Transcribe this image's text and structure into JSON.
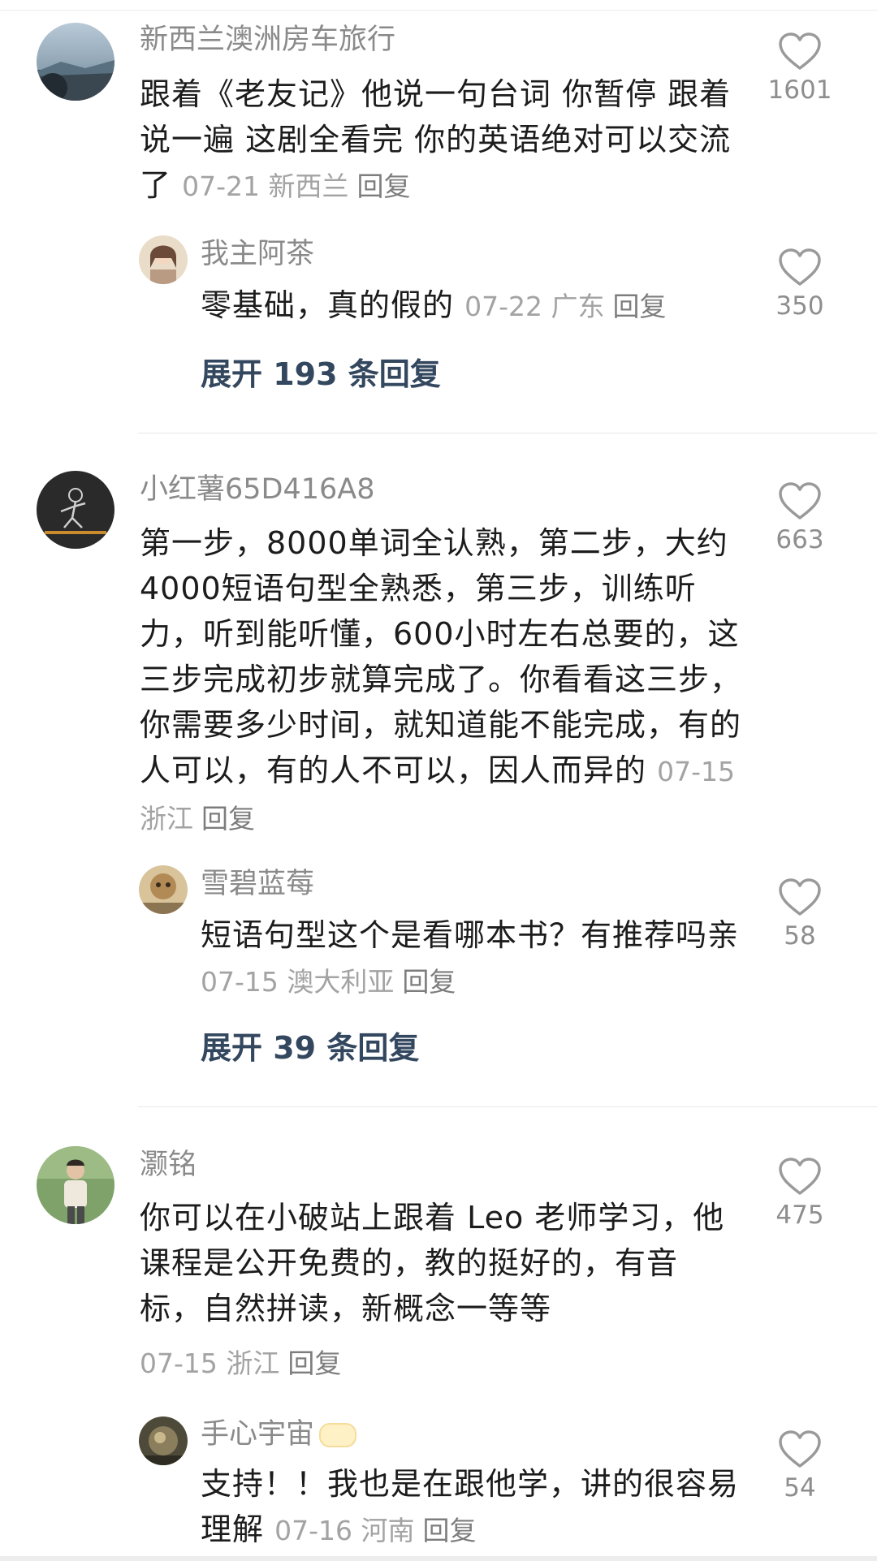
{
  "threads": [
    {
      "user": "新西兰澳洲房车旅行",
      "text": "跟着《老友记》他说一句台词 你暂停 跟着说一遍 这剧全看完 你的英语绝对可以交流了",
      "date": "07-21",
      "location": "新西兰",
      "reply_label": "回复",
      "likes": "1601",
      "reply": {
        "user": "我主阿茶",
        "text": "零基础，真的假的",
        "date": "07-22",
        "location": "广东",
        "reply_label": "回复",
        "likes": "350"
      },
      "expand": "展开 193 条回复"
    },
    {
      "user": "小红薯65D416A8",
      "text": "第一步，8000单词全认熟，第二步，大约4000短语句型全熟悉，第三步，训练听力，听到能听懂，600小时左右总要的，这三步完成初步就算完成了。你看看这三步，你需要多少时间，就知道能不能完成，有的人可以，有的人不可以，因人而异的",
      "date": "07-15",
      "location": "浙江",
      "reply_label": "回复",
      "likes": "663",
      "reply": {
        "user": "雪碧蓝莓",
        "text": "短语句型这个是看哪本书？有推荐吗亲",
        "date": "07-15",
        "location": "澳大利亚",
        "reply_label": "回复",
        "likes": "58"
      },
      "expand": "展开 39 条回复"
    },
    {
      "user": "灏铭",
      "text": "你可以在小破站上跟着 Leo 老师学习，他课程是公开免费的，教的挺好的，有音标，自然拼读，新概念一等等",
      "date": "07-15",
      "location": "浙江",
      "reply_label": "回复",
      "likes": "475",
      "reply": {
        "user": "手心宇宙",
        "text": "支持！！我也是在跟他学，讲的很容易理解",
        "date": "07-16",
        "location": "河南",
        "reply_label": "回复",
        "likes": "54"
      }
    }
  ],
  "colors": {
    "username": "#8a8a8a",
    "text": "#1c1c1c",
    "meta": "#a3a3a3",
    "expand": "#33475f",
    "heart": "#9a9a9a"
  }
}
